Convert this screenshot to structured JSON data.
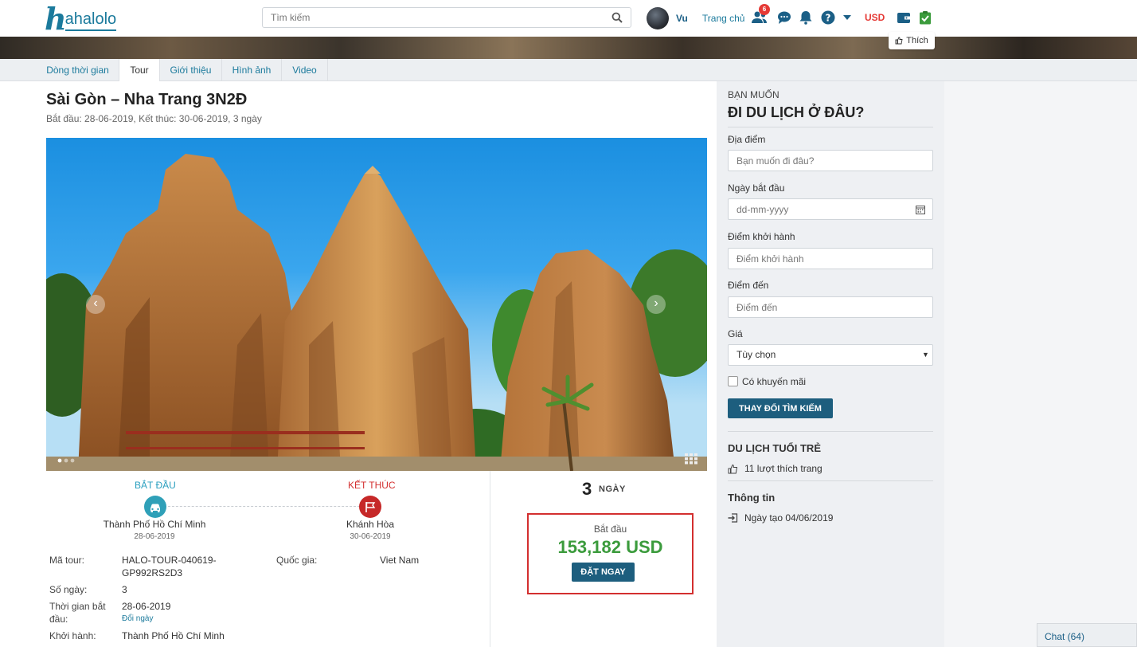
{
  "navbar": {
    "logo_h": "h",
    "logo_rest": "ahalolo",
    "search_placeholder": "Tìm kiếm",
    "user_name": "Vu",
    "home_label": "Trang chủ",
    "friend_badge": "6",
    "currency": "USD"
  },
  "cover": {
    "like_label": "Thích"
  },
  "tabs": [
    {
      "label": "Dòng thời gian"
    },
    {
      "label": "Tour"
    },
    {
      "label": "Giới thiệu"
    },
    {
      "label": "Hình ảnh"
    },
    {
      "label": "Video"
    }
  ],
  "tour": {
    "title": "Sài Gòn – Nha Trang 3N2Đ",
    "dates": "Bắt đầu: 28-06-2019, Kết thúc: 30-06-2019, 3 ngày",
    "start_label": "BẮT ĐẦU",
    "end_label": "KẾT THÚC",
    "start_city": "Thành Phố Hồ Chí Minh",
    "start_date": "28-06-2019",
    "end_city": "Khánh Hòa",
    "end_date": "30-06-2019",
    "info": {
      "code_label": "Mã tour:",
      "code_line1": "HALO-TOUR-040619-",
      "code_line2": "GP992RS2D3",
      "country_label": "Quốc gia:",
      "country": "Viet Nam",
      "days_label": "Số ngày:",
      "days": "3",
      "start_time_label_1": "Thời gian bắt",
      "start_time_label_2": "đầu:",
      "start_time": "28-06-2019",
      "change_date": "Đổi ngày",
      "depart_label": "Khởi hành:",
      "depart": "Thành Phố Hồ Chí Minh"
    },
    "duration_num": "3",
    "duration_word": "NGÀY",
    "price_start_label": "Bắt đầu",
    "price": "153,182 USD",
    "book_label": "ĐẶT NGAY"
  },
  "sidebar": {
    "small_title": "BẠN MUỐN",
    "big_title": "ĐI DU LỊCH Ở ĐÂU?",
    "location_label": "Địa điểm",
    "location_placeholder": "Bạn muốn đi đâu?",
    "start_date_label": "Ngày bắt đầu",
    "start_date_placeholder": "dd-mm-yyyy",
    "depart_label": "Điểm khởi hành",
    "depart_placeholder": "Điểm khởi hành",
    "dest_label": "Điểm đến",
    "dest_placeholder": "Điểm đến",
    "price_label": "Giá",
    "price_option": "Tùy chọn",
    "promo_label": "Có khuyến mãi",
    "search_btn": "THAY ĐỔI TÌM KIẾM",
    "page_name": "DU LỊCH TUỔI TRẺ",
    "likes": "11 lượt thích trang",
    "info_title": "Thông tin",
    "created": "Ngày tạo 04/06/2019"
  },
  "chat": {
    "label": "Chat (64)"
  },
  "colors": {
    "brand": "#1b7a9c",
    "button": "#1d5e7e",
    "price": "#3b9b3c",
    "alert": "#d32f2f"
  }
}
